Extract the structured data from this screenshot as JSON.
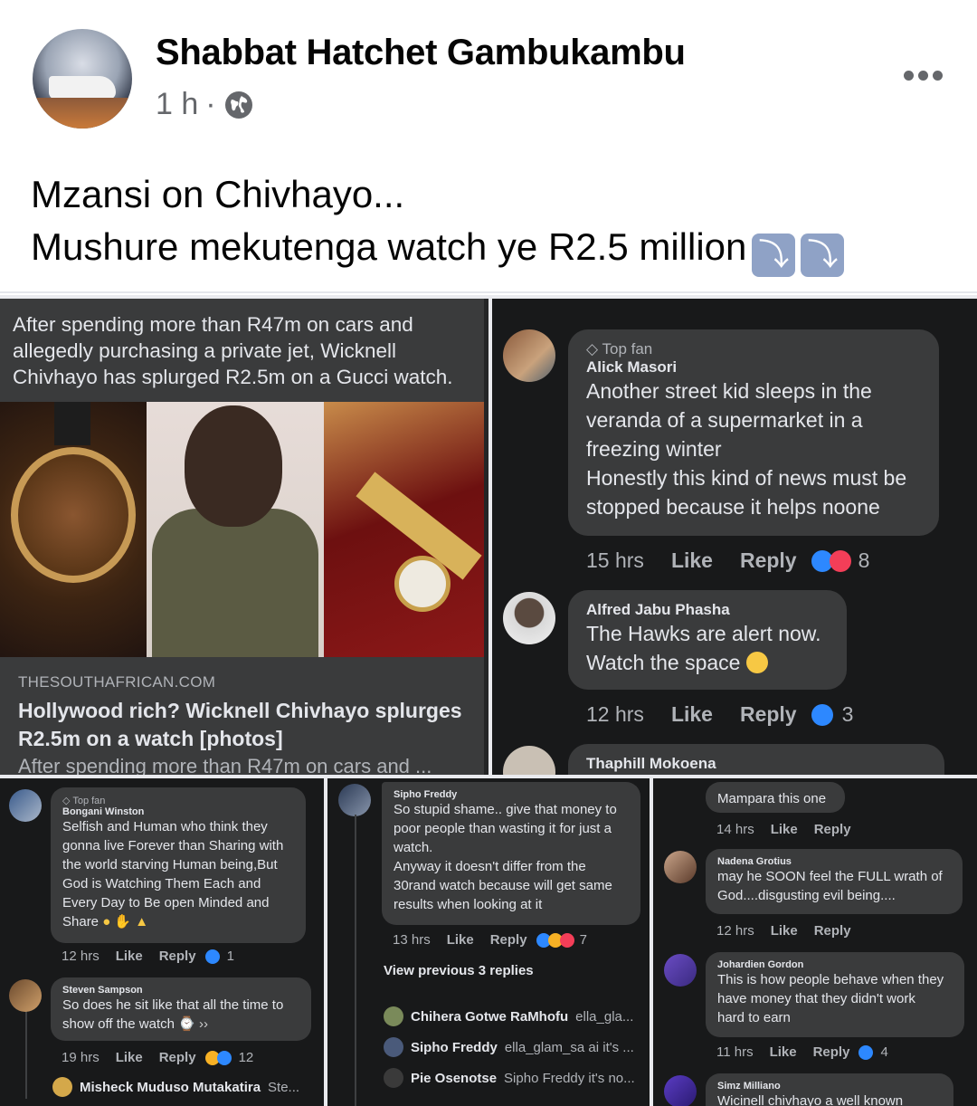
{
  "post": {
    "author": "Shabbat Hatchet Gambukambu",
    "time": "1 h",
    "separator": "·",
    "text_line1": "Mzansi on Chivhayo...",
    "text_line2": "Mushure mekutenga watch ye R2.5 million",
    "emoji": "⤵"
  },
  "article": {
    "caption": "After spending more than R47m on cars and allegedly purchasing a private jet, Wicknell Chivhayo has splurged R2.5m on a Gucci watch.",
    "domain": "THESOUTHAFRICAN.COM",
    "title": "Hollywood rich? Wicknell Chivhayo splurges R2.5m on a watch [photos]",
    "snippet": "After spending more than R47m on cars and ..."
  },
  "comments1": [
    {
      "badge": "Top fan",
      "name": "Alick Masori",
      "text1": "Another street kid sleeps in the",
      "text2": "veranda of a supermarket in a",
      "text3": "freezing winter",
      "text4": "Honestly this kind of news must be",
      "text5": "stopped because it helps noone",
      "time": "15 hrs",
      "like": "Like",
      "reply": "Reply",
      "count": "8"
    },
    {
      "name": "Alfred Jabu Phasha",
      "text1": "The Hawks are alert now.",
      "text2": "Watch the space",
      "time": "12 hrs",
      "like": "Like",
      "reply": "Reply",
      "count": "3"
    },
    {
      "name": "Thaphill Mokoena"
    }
  ],
  "comments2": {
    "c1": {
      "badge": "Top fan",
      "name": "Bongani Winston",
      "lines": [
        "Selfish and Human who think they",
        "gonna live Forever than Sharing with",
        "the world starving Human being,But",
        "God is Watching Them Each and",
        "Every Day to Be open Minded and",
        "Share"
      ],
      "time": "12 hrs",
      "like": "Like",
      "reply": "Reply",
      "count": "1"
    },
    "c2": {
      "name": "Steven Sampson",
      "lines": [
        "So does he sit like that all the time to",
        "show off the watch"
      ],
      "time": "19 hrs",
      "like": "Like",
      "reply": "Reply",
      "count": "12"
    },
    "reply": {
      "name": "Misheck Muduso Mutakatira",
      "text": "Ste..."
    }
  },
  "comments3": {
    "c1": {
      "name": "Sipho Freddy",
      "lines": [
        "So stupid shame.. give that money to",
        "poor people than wasting it for just a",
        "watch.",
        "Anyway it doesn't differ from the",
        "30rand watch because will get same",
        "results when looking at it"
      ],
      "time": "13 hrs",
      "like": "Like",
      "reply": "Reply",
      "count": "7"
    },
    "view_previous": "View previous 3 replies",
    "replies": [
      {
        "name": "Chihera Gotwe RaMhofu",
        "text": "ella_gla..."
      },
      {
        "name": "Sipho Freddy",
        "text": "ella_glam_sa ai it's ..."
      },
      {
        "name": "Pie Osenotse",
        "text": "Sipho Freddy it's no..."
      }
    ]
  },
  "comments4": {
    "c0": {
      "text": "Mampara this one",
      "time": "14 hrs",
      "like": "Like",
      "reply": "Reply"
    },
    "c1": {
      "name": "Nadena Grotius",
      "lines": [
        "may he SOON feel the FULL wrath of",
        "God....disgusting evil being...."
      ],
      "time": "12 hrs",
      "like": "Like",
      "reply": "Reply"
    },
    "c2": {
      "name": "Johardien Gordon",
      "lines": [
        "This is how people behave when they",
        "have money that they didn't work",
        "hard to earn"
      ],
      "time": "11 hrs",
      "like": "Like",
      "reply": "Reply",
      "count": "4"
    },
    "c3": {
      "name": "Simz Milliano",
      "text": "Wicinell chivhayo a well known"
    }
  },
  "colors": {
    "dark_bg": "#18191a",
    "bubble": "#3a3b3c",
    "like_blue": "#2d88ff",
    "love_red": "#f33e58"
  },
  "icons": [
    "globe-icon",
    "more-icon",
    "like-reaction-icon",
    "love-reaction-icon",
    "top-fan-icon"
  ]
}
